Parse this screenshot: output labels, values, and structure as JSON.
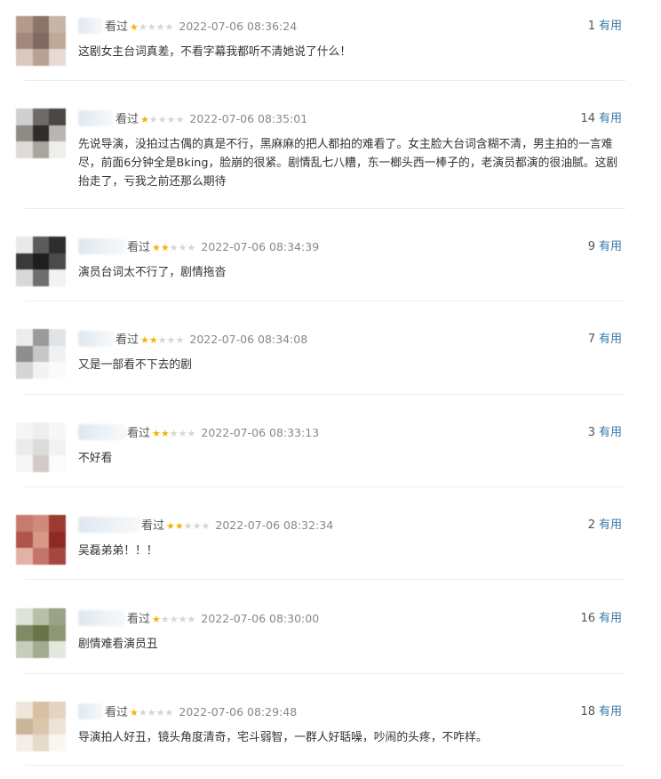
{
  "useful_label": "有用",
  "seen_label": "看过",
  "star_glyph": "★",
  "colors": {
    "star_on": "#f4b400",
    "star_off": "#d6d6d6",
    "useful": "#3377aa",
    "separator": "#ececec"
  },
  "comments": [
    {
      "rating": 1,
      "time": "2022-07-06 08:36:24",
      "useful_count": "1",
      "text": "这剧女主台词真差，不看字幕我都听不清她说了什么！"
    },
    {
      "rating": 1,
      "time": "2022-07-06 08:35:01",
      "useful_count": "14",
      "text": "先说导演，没拍过古偶的真是不行，黑麻麻的把人都拍的难看了。女主脸大台词含糊不清，男主拍的一言难尽，前面6分钟全是Bking，脸崩的很紧。剧情乱七八糟，东一榔头西一棒子的，老演员都演的很油腻。这剧抬走了，亏我之前还那么期待"
    },
    {
      "rating": 2,
      "time": "2022-07-06 08:34:39",
      "useful_count": "9",
      "text": "演员台词太不行了，剧情拖沓"
    },
    {
      "rating": 2,
      "time": "2022-07-06 08:34:08",
      "useful_count": "7",
      "text": "又是一部看不下去的剧"
    },
    {
      "rating": 2,
      "time": "2022-07-06 08:33:13",
      "useful_count": "3",
      "text": "不好看"
    },
    {
      "rating": 2,
      "time": "2022-07-06 08:32:34",
      "useful_count": "2",
      "text": "吴磊弟弟！！！"
    },
    {
      "rating": 1,
      "time": "2022-07-06 08:30:00",
      "useful_count": "16",
      "text": "剧情难看演员丑"
    },
    {
      "rating": 1,
      "time": "2022-07-06 08:29:48",
      "useful_count": "18",
      "text": "导演拍人好丑，镜头角度清奇，宅斗弱智，一群人好聒噪，吵闹的头疼，不咋样。"
    }
  ]
}
